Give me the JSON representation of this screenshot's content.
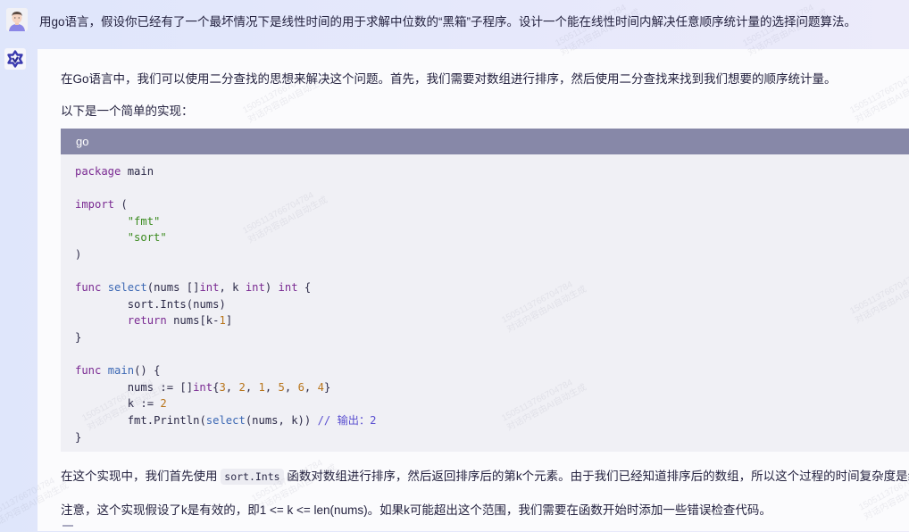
{
  "user_message": {
    "avatar": "user-avatar",
    "text": "用go语言，假设你已经有了一个最坏情况下是线性时间的用于求解中位数的“黑箱”子程序。设计一个能在线性时间内解决任意顺序统计量的选择问题算法。"
  },
  "ai_message": {
    "avatar": "ai-logo-icon",
    "intro": "在Go语言中，我们可以使用二分查找的思想来解决这个问题。首先，我们需要对数组进行排序，然后使用二分查找来找到我们想要的顺序统计量。",
    "lead": "以下是一个简单的实现：",
    "code": {
      "language": "go",
      "lines": [
        "package main",
        "",
        "import (",
        "\t\"fmt\"",
        "\t\"sort\"",
        ")",
        "",
        "func select(nums []int, k int) int {",
        "\tsort.Ints(nums)",
        "\treturn nums[k-1]",
        "}",
        "",
        "func main() {",
        "\tnums := []int{3, 2, 1, 5, 6, 4}",
        "\tk := 2",
        "\tfmt.Println(select(nums, k)) // 输出：2",
        "}"
      ]
    },
    "explanation_before": "在这个实现中，我们首先使用",
    "explanation_code": "sort.Ints",
    "explanation_after": "函数对数组进行排序，然后返回排序后的第k个元素。由于我们已经知道排序后的数组，所以这个过程的时间复杂度是线性的。",
    "note": "注意，这个实现假设了k是有效的，即1 <= k <= len(nums)。如果k可能超出这个范围，我们需要在函数开始时添加一些错误检查代码。"
  },
  "watermark": {
    "line1": "15051137667047​84",
    "line2": "对话内容由AI自动生成"
  },
  "colors": {
    "code_header": "#8788a8",
    "code_bg": "#f0f0f5",
    "keyword": "#7a2a92",
    "function": "#3c68b4",
    "string": "#3a8a1e",
    "number": "#b8741a",
    "comment": "#5a4fd0"
  }
}
